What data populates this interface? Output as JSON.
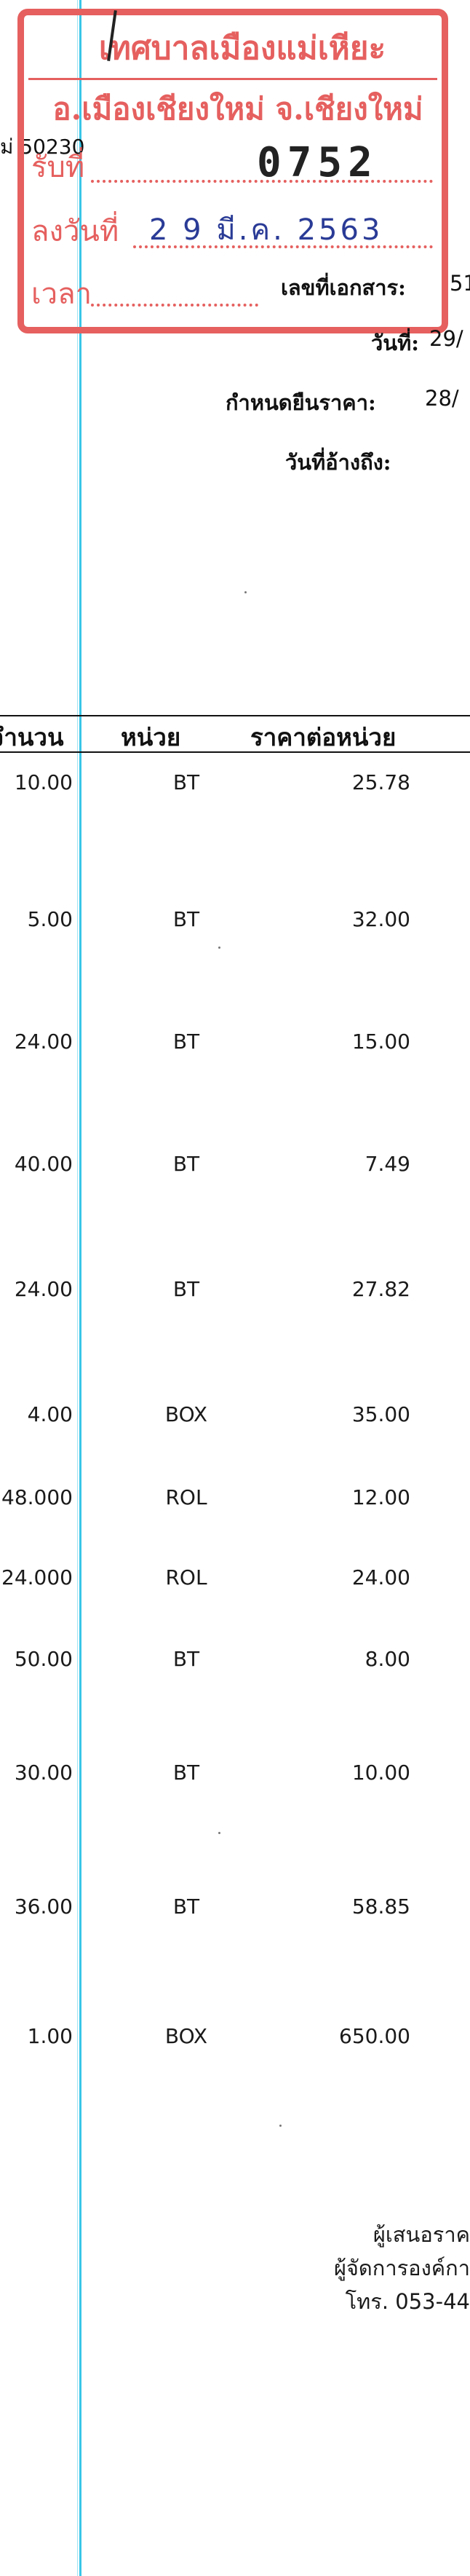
{
  "stamp": {
    "line1": "เทศบาลเมืองแม่เหียะ",
    "line2": "อ.เมืองเชียงใหม่ จ.เชียงใหม่",
    "received_label": "รับที่",
    "received_no": "0752",
    "date_label": "ลงวันที่",
    "date_value": "2 9 มี.ค. 2563",
    "time_label": "เวลา"
  },
  "left_zip": "ม่ 50230",
  "meta": {
    "doc_no_label": "เลขที่เอกสาร:",
    "doc_no_value": "51",
    "date_label": "วันที่:",
    "date_value": "29/",
    "price_valid_label": "กำหนดยืนราคา:",
    "price_valid_value": "28/",
    "ref_date_label": "วันที่อ้างถึง:"
  },
  "table": {
    "headers": [
      "จำนวน",
      "หน่วย",
      "ราคาต่อหน่วย"
    ],
    "rows": [
      {
        "qty": "10.00",
        "unit": "BT",
        "price": "25.78"
      },
      {
        "qty": "5.00",
        "unit": "BT",
        "price": "32.00"
      },
      {
        "qty": "24.00",
        "unit": "BT",
        "price": "15.00"
      },
      {
        "qty": "40.00",
        "unit": "BT",
        "price": "7.49"
      },
      {
        "qty": "24.00",
        "unit": "BT",
        "price": "27.82"
      },
      {
        "qty": "4.00",
        "unit": "BOX",
        "price": "35.00"
      },
      {
        "qty": "48.000",
        "unit": "ROL",
        "price": "12.00"
      },
      {
        "qty": "24.000",
        "unit": "ROL",
        "price": "24.00"
      },
      {
        "qty": "50.00",
        "unit": "BT",
        "price": "8.00"
      },
      {
        "qty": "30.00",
        "unit": "BT",
        "price": "10.00"
      },
      {
        "qty": "36.00",
        "unit": "BT",
        "price": "58.85"
      },
      {
        "qty": "1.00",
        "unit": "BOX",
        "price": "650.00"
      }
    ]
  },
  "footer": {
    "line1": "ผู้เสนอราค",
    "line2": "ผู้จัดการองค์กา",
    "line3": "โทร. 053-44"
  },
  "colors": {
    "stamp_red": "#e5605f",
    "stamp_blue": "#2a3b96",
    "scan_line": "#39c6e8"
  }
}
